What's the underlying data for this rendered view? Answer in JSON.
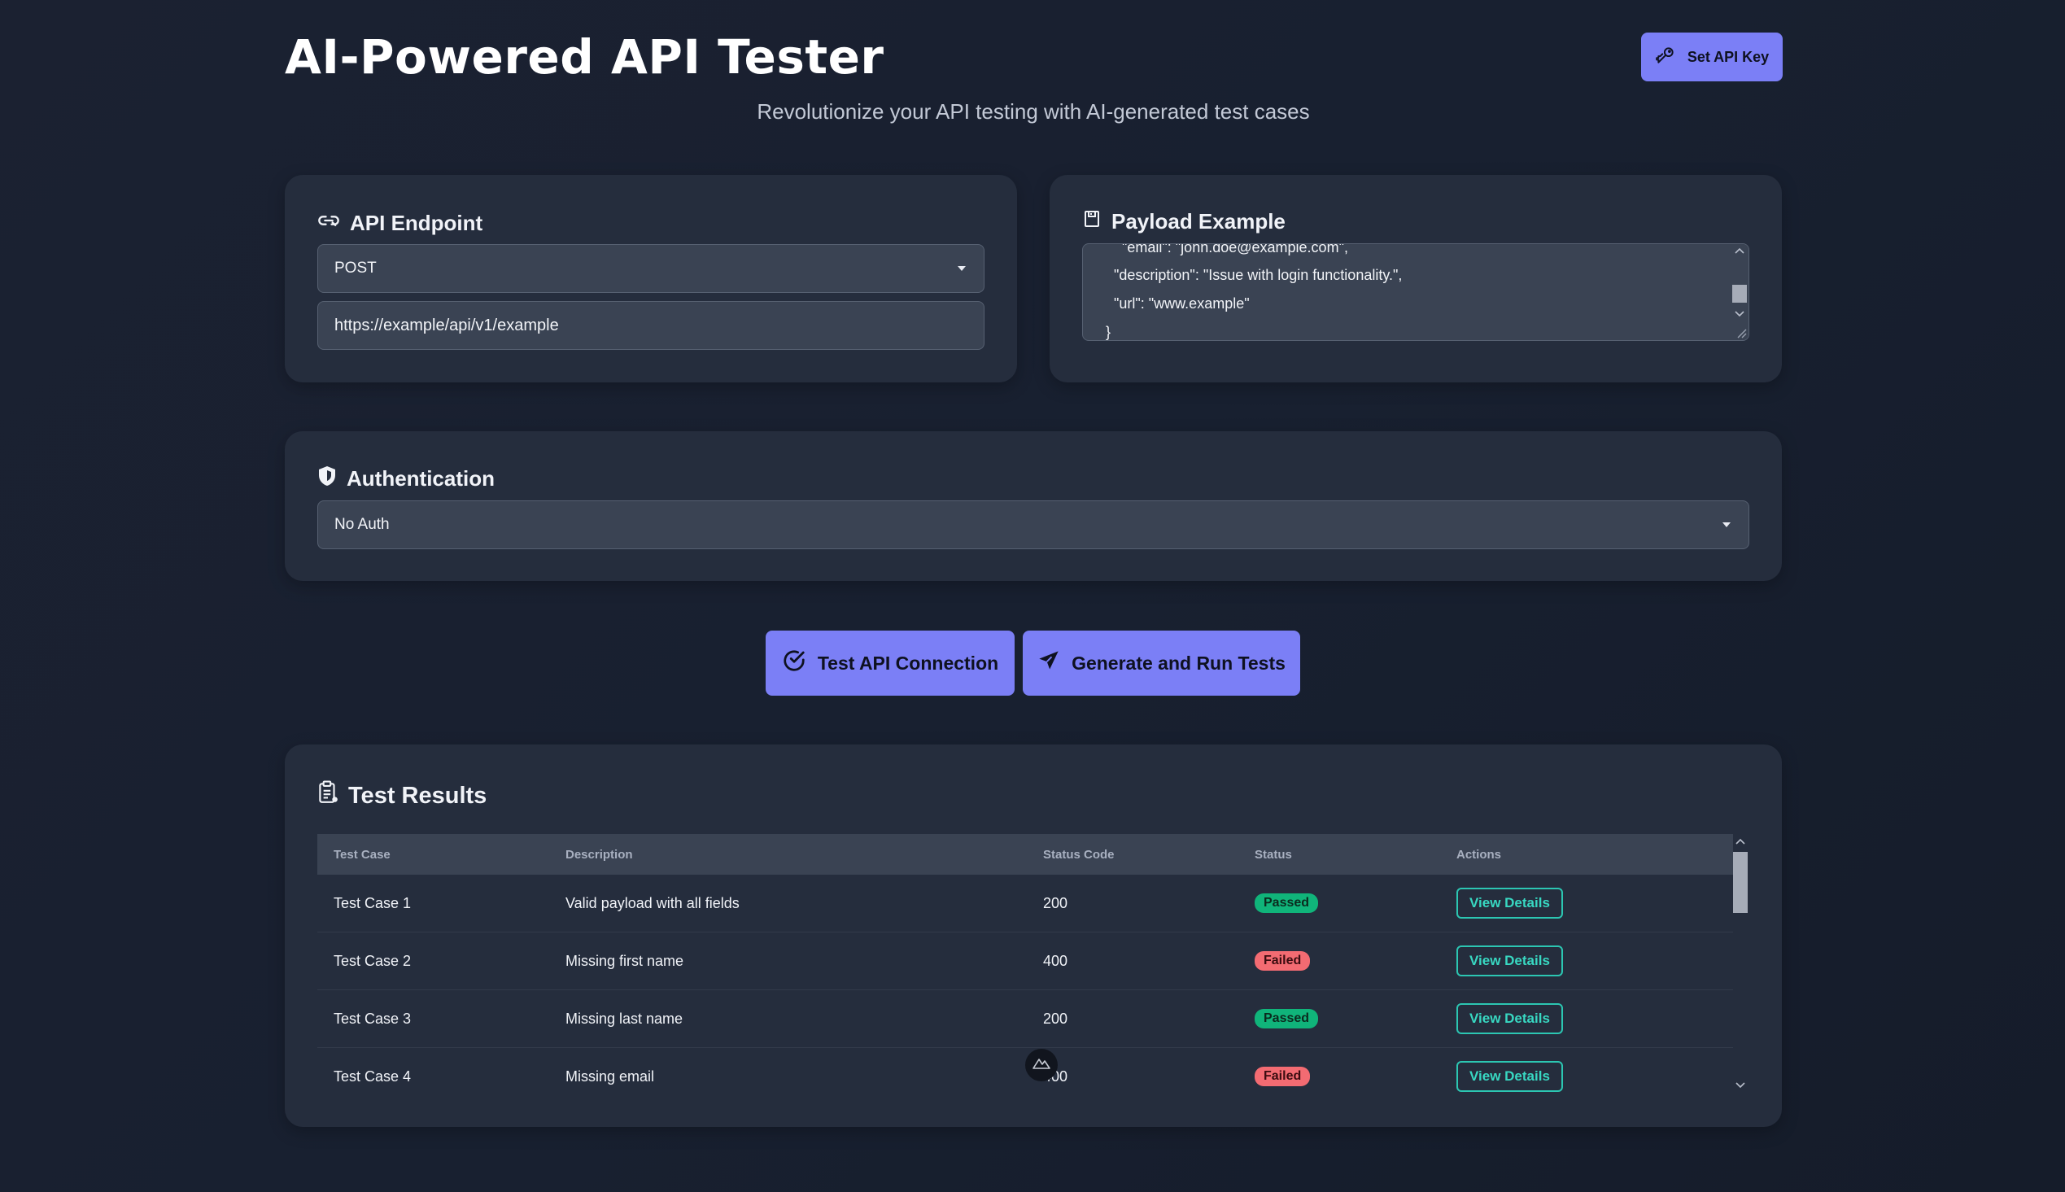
{
  "header": {
    "title": "AI-Powered API Tester",
    "subtitle": "Revolutionize your API testing with AI-generated test cases",
    "api_key_button": "Set API Key"
  },
  "endpoint": {
    "heading": "API Endpoint",
    "method": "POST",
    "url": "https://example/api/v1/example"
  },
  "payload": {
    "heading": "Payload Example",
    "lines": [
      "  \"email\": \"john.doe@example.com\",",
      "\"description\": \"Issue with login functionality.\",",
      "\"url\": \"www.example\"",
      "}"
    ]
  },
  "auth": {
    "heading": "Authentication",
    "selected": "No Auth"
  },
  "actions": {
    "test_connection": "Test API Connection",
    "generate_run": "Generate and Run Tests"
  },
  "results": {
    "heading": "Test Results",
    "columns": [
      "Test Case",
      "Description",
      "Status Code",
      "Status",
      "Actions"
    ],
    "rows": [
      {
        "name": "Test Case 1",
        "description": "Valid payload with all fields",
        "code": "200",
        "status": "Passed",
        "action": "View Details"
      },
      {
        "name": "Test Case 2",
        "description": "Missing first name",
        "code": "400",
        "status": "Failed",
        "action": "View Details"
      },
      {
        "name": "Test Case 3",
        "description": "Missing last name",
        "code": "200",
        "status": "Passed",
        "action": "View Details"
      },
      {
        "name": "Test Case 4",
        "description": "Missing email",
        "code": "400",
        "status": "Failed",
        "action": "View Details"
      }
    ]
  },
  "colors": {
    "accent": "#7b7ff6",
    "passed": "#10b47a",
    "failed": "#f36b72",
    "card": "#252d3d",
    "link": "#2cc6b2"
  }
}
